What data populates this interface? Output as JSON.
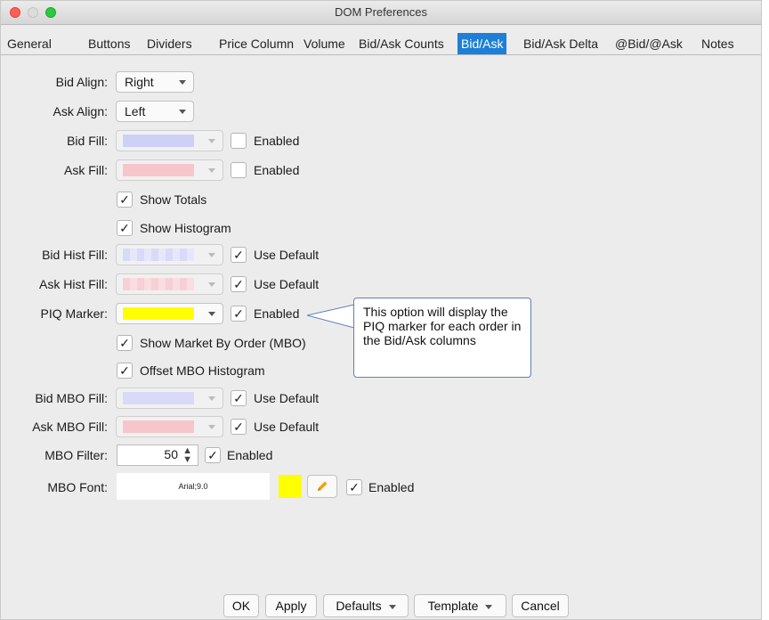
{
  "window": {
    "title": "DOM Preferences"
  },
  "tabs": [
    {
      "label": "General"
    },
    {
      "label": "Buttons"
    },
    {
      "label": "Dividers"
    },
    {
      "label": "Price Column"
    },
    {
      "label": "Volume"
    },
    {
      "label": "Bid/Ask Counts"
    },
    {
      "label": "Bid/Ask",
      "active": true
    },
    {
      "label": "Bid/Ask Delta"
    },
    {
      "label": "@Bid/@Ask"
    },
    {
      "label": "Notes"
    }
  ],
  "form": {
    "bid_align": {
      "label": "Bid Align:",
      "value": "Right"
    },
    "ask_align": {
      "label": "Ask Align:",
      "value": "Left"
    },
    "bid_fill": {
      "label": "Bid Fill:",
      "color": "#cfd0f6",
      "checkbox": "Enabled",
      "checked": false
    },
    "ask_fill": {
      "label": "Ask Fill:",
      "color": "#f6c6cb",
      "checkbox": "Enabled",
      "checked": false
    },
    "show_totals": {
      "label": "Show Totals",
      "checked": true
    },
    "show_histogram": {
      "label": "Show Histogram",
      "checked": true
    },
    "bid_hist_fill": {
      "label": "Bid Hist Fill:",
      "color": "#d9daf7",
      "checkbox": "Use Default",
      "checked": true
    },
    "ask_hist_fill": {
      "label": "Ask Hist Fill:",
      "color": "#f6d0d5",
      "checkbox": "Use Default",
      "checked": true
    },
    "piq_marker": {
      "label": "PIQ Marker:",
      "color": "#ffff00",
      "checkbox": "Enabled",
      "checked": true
    },
    "show_mbo": {
      "label": "Show Market By Order (MBO)",
      "checked": true
    },
    "offset_mbo": {
      "label": "Offset MBO Histogram",
      "checked": true
    },
    "bid_mbo_fill": {
      "label": "Bid MBO Fill:",
      "color": "#d9daf7",
      "checkbox": "Use Default",
      "checked": true
    },
    "ask_mbo_fill": {
      "label": "Ask MBO Fill:",
      "color": "#f6c6cb",
      "checkbox": "Use Default",
      "checked": true
    },
    "mbo_filter": {
      "label": "MBO Filter:",
      "value": "50",
      "checkbox": "Enabled",
      "checked": true
    },
    "mbo_font": {
      "label": "MBO Font:",
      "value": "Arial;9.0",
      "color": "#ffff00",
      "checkbox": "Enabled",
      "checked": true
    }
  },
  "callout": {
    "text": "This option will display the PIQ marker for each order in the Bid/Ask columns"
  },
  "buttons": {
    "ok": "OK",
    "apply": "Apply",
    "defaults": "Defaults",
    "template": "Template",
    "cancel": "Cancel"
  },
  "icons": {
    "check": "checkmark-icon",
    "pencil": "pencil-icon",
    "dropdown": "chevron-down-icon"
  },
  "colors": {
    "accent": "#1e7fd6",
    "pencil": "#f0a500"
  }
}
